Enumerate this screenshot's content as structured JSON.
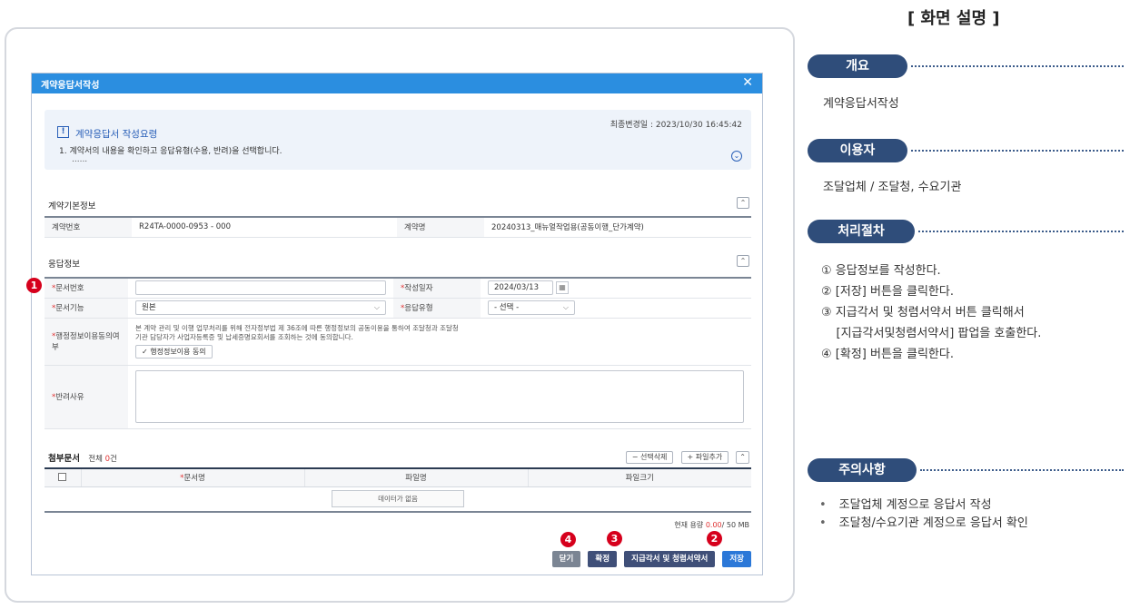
{
  "modal": {
    "title": "계약응답서작성",
    "close": "✕",
    "notice": {
      "icon": "!",
      "title": "계약응답서 작성요령",
      "text": "1. 계약서의 내용을 확인하고 응답유형(수용, 반려)을 선택합니다.",
      "more": "......",
      "last_modified": "최종변경일 : 2023/10/30 16:45:42",
      "toggle": "⌄"
    },
    "contract_info": {
      "title": "계약기본정보",
      "contract_no_label": "계약번호",
      "contract_no": "R24TA-0000-0953 - 000",
      "contract_name_label": "계약명",
      "contract_name": "20240313_매뉴얼작업용(공동이행_단가계약)"
    },
    "response_info": {
      "title": "응답정보",
      "doc_no_label": "문서번호",
      "doc_no": "",
      "date_label": "작성일자",
      "date": "2024/03/13",
      "doc_type_label": "문서기능",
      "doc_type": "원본",
      "response_type_label": "응답유형",
      "response_type": "- 선택 -",
      "consent_label": "행정정보이용동의여부",
      "consent_text_1": "본 계약 관리 및 이행 업무처리를 위해 전자정부법 제 36조에 따른 행정정보의 공동이용을 통하여 조달청과 조달청",
      "consent_text_2": "기관 담당자가 사업자등록증 및 납세증명요회서를 조회하는 것에 동의합니다.",
      "consent_button": "✓ 행정정보이용 동의",
      "reject_label": "반려사유"
    },
    "attachments": {
      "title": "첨부문서",
      "count_prefix": "전체 ",
      "count": "0",
      "count_suffix": "건",
      "delete_button": "− 선택삭제",
      "add_button": "+ 파일추가",
      "columns": [
        "문서명",
        "파일명",
        "파일크기"
      ],
      "no_data": "데이터가 없음",
      "capacity_label": "현재 용량 ",
      "capacity_used": "0.00",
      "capacity_total": "/ 50 MB"
    },
    "buttons": {
      "close": "닫기",
      "confirm": "확정",
      "pay_request": "지급각서 및 청렴서약서",
      "save": "저장"
    }
  },
  "markers": [
    "1",
    "2",
    "3",
    "4"
  ],
  "panel": {
    "title": "[ 화면 설명 ]",
    "overview_label": "개요",
    "overview_text": "계약응답서작성",
    "user_label": "이용자",
    "user_text": "조달업체 / 조달청, 수요기관",
    "process_label": "처리절차",
    "steps": [
      "① 응답정보를 작성한다.",
      "② [저장] 버튼을 클릭한다.",
      "③ 지급각서 및 청렴서약서 버튼 클릭해서",
      "    [지급각서및청렴서약서] 팝업을 호출한다.",
      "④ [확정] 버튼을 클릭한다."
    ],
    "notes_label": "주의사항",
    "notes": [
      "조달업체 계정으로 응답서 작성",
      "조달청/수요기관 계정으로 응답서 확인"
    ]
  },
  "colors": {
    "header_blue": "#2b8ee0",
    "pill_navy": "#2f4d7a",
    "marker_red": "#d6001c",
    "save_blue": "#2b78d8"
  }
}
